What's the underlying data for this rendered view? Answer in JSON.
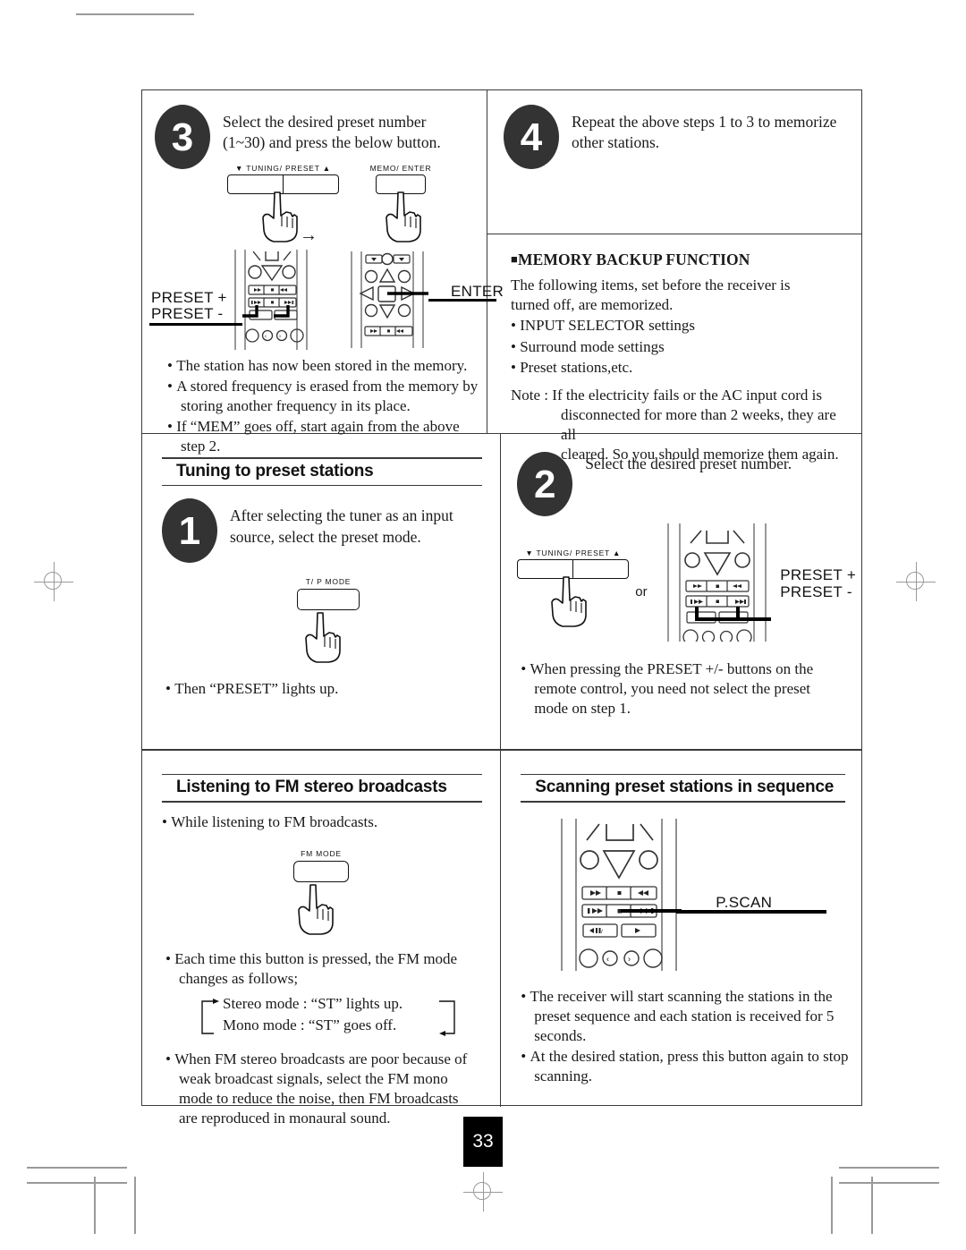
{
  "page": {
    "number": "33"
  },
  "panels": {
    "step3": {
      "number": "3",
      "instruction": "Select the desired preset number (1~30) and press the below button.",
      "buttons": {
        "tuning_preset": "▼ TUNING/ PRESET ▲",
        "memo_enter": "MEMO/ ENTER"
      },
      "arrow": "→",
      "callouts": {
        "preset_plus": "PRESET +",
        "preset_minus": "PRESET -",
        "enter": "ENTER"
      },
      "notes": [
        "The station has now been stored in the memory.",
        "A stored frequency is erased from the memory by storing another frequency in its place.",
        "If “MEM” goes off, start again from the above step 2."
      ]
    },
    "step4": {
      "number": "4",
      "instruction": "Repeat the above steps 1 to 3 to memorize other stations."
    },
    "memory_backup": {
      "marker": "■",
      "title": "MEMORY BACKUP FUNCTION",
      "intro": "The following items, set before the receiver is turned off, are memorized.",
      "items": [
        "INPUT SELECTOR settings",
        "Surround mode settings",
        "Preset stations,etc."
      ],
      "note_label": "Note : ",
      "note_line1": "If the electricity fails or the AC input cord is",
      "note_line2": "disconnected for more than 2 weeks, they are all",
      "note_line3": "cleared. So you should memorize them again."
    },
    "tuning_preset": {
      "title": "Tuning to preset stations",
      "step": {
        "number": "1",
        "instruction": "After selecting the tuner as an input source, select the preset mode."
      },
      "button_label": "T/ P MODE",
      "notes": [
        "Then “PRESET” lights up."
      ]
    },
    "select_preset_number": {
      "step": {
        "number": "2",
        "instruction": "Select the desired preset number."
      },
      "button_label": "▼ TUNING/ PRESET ▲",
      "or_text": "or",
      "callouts": {
        "preset_plus": "PRESET +",
        "preset_minus": "PRESET -"
      },
      "notes": [
        "When pressing the PRESET +/- buttons on the remote control, you need not select the preset mode on step 1."
      ]
    },
    "fm_stereo": {
      "title": "Listening to FM stereo broadcasts",
      "notes_top": [
        "While listening to FM broadcasts."
      ],
      "button_label": "FM MODE",
      "notes_mid": [
        "Each time this button is pressed, the FM mode changes as follows;"
      ],
      "mode_cycle": {
        "stereo": "Stereo mode : “ST” lights up.",
        "mono": "Mono mode : “ST” goes off."
      },
      "notes_bottom": [
        "When FM stereo broadcasts are poor because of weak broadcast signals, select the FM mono mode to reduce the noise, then FM broadcasts are reproduced in monaural sound."
      ]
    },
    "p_scan": {
      "title": "Scanning preset stations in sequence",
      "callout": "P.SCAN",
      "notes": [
        "The receiver will start scanning the stations in the preset sequence and each station is received for 5 seconds.",
        "At the desired station, press this button again to stop scanning."
      ]
    }
  },
  "colors": {
    "ink": "#1a1a1a",
    "rule": "#3a3a3a",
    "bubble": "#333333",
    "cropmark": "#9a9a9a",
    "pagebox": "#000000"
  }
}
